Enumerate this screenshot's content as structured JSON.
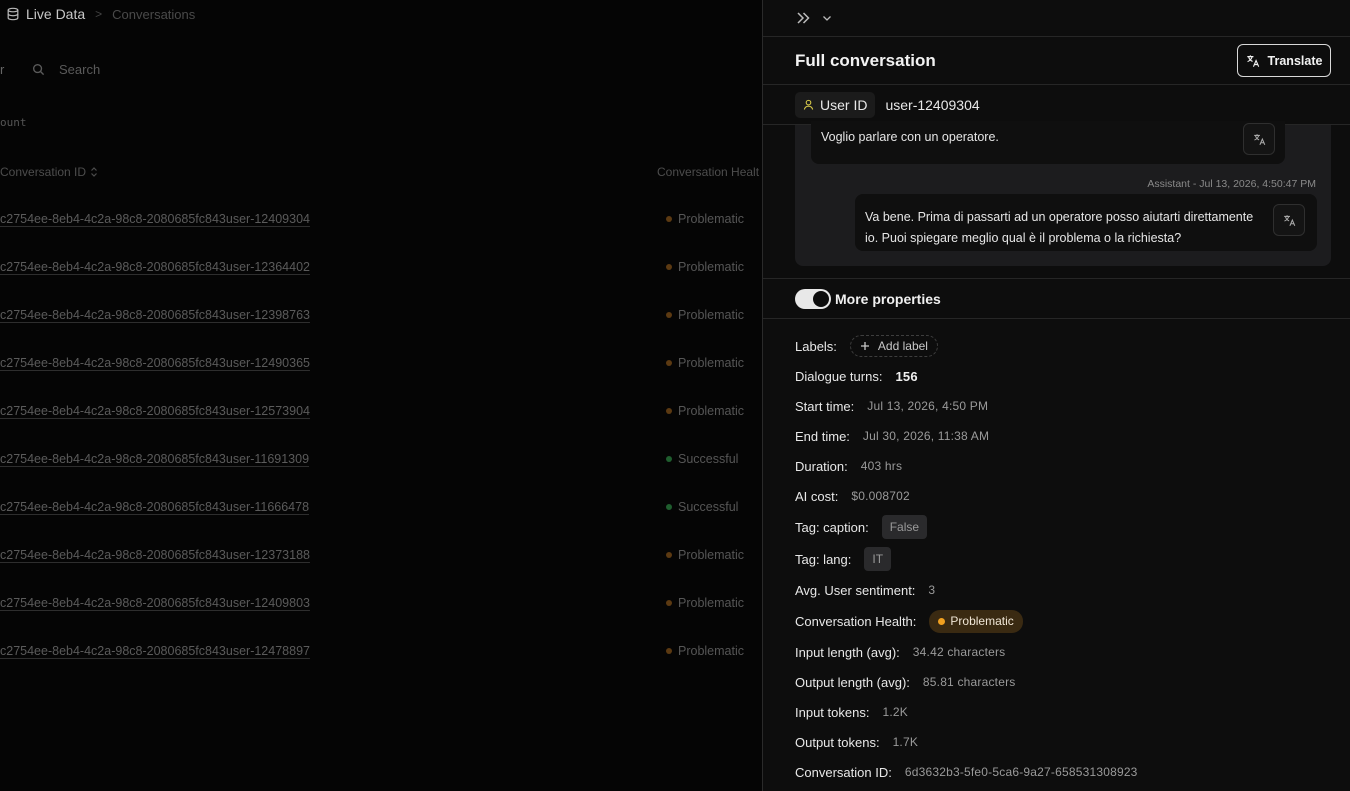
{
  "breadcrumb": {
    "root": "Live Data",
    "separator": ">",
    "current": "Conversations"
  },
  "list": {
    "filter_fragment": "r",
    "search_placeholder": "Search",
    "count_fragment": "ount",
    "columns": {
      "id": "Conversation ID",
      "health": "Conversation Healt"
    },
    "rows": [
      {
        "id": "c2754ee-8eb4-4c2a-98c8-2080685fc843user-12409304",
        "health": "Problematic"
      },
      {
        "id": "c2754ee-8eb4-4c2a-98c8-2080685fc843user-12364402",
        "health": "Problematic"
      },
      {
        "id": "c2754ee-8eb4-4c2a-98c8-2080685fc843user-12398763",
        "health": "Problematic"
      },
      {
        "id": "c2754ee-8eb4-4c2a-98c8-2080685fc843user-12490365",
        "health": "Problematic"
      },
      {
        "id": "c2754ee-8eb4-4c2a-98c8-2080685fc843user-12573904",
        "health": "Problematic"
      },
      {
        "id": "c2754ee-8eb4-4c2a-98c8-2080685fc843user-11691309",
        "health": "Successful"
      },
      {
        "id": "c2754ee-8eb4-4c2a-98c8-2080685fc843user-11666478",
        "health": "Successful"
      },
      {
        "id": "c2754ee-8eb4-4c2a-98c8-2080685fc843user-12373188",
        "health": "Problematic"
      },
      {
        "id": "c2754ee-8eb4-4c2a-98c8-2080685fc843user-12409803",
        "health": "Problematic"
      },
      {
        "id": "c2754ee-8eb4-4c2a-98c8-2080685fc843user-12478897",
        "health": "Problematic"
      }
    ]
  },
  "colors": {
    "problematic_dot": "#5c3a12",
    "successful_dot": "#1f5e2e",
    "problematic_badge_dot": "#f0a020"
  },
  "panel": {
    "title": "Full conversation",
    "translate_label": "Translate",
    "user_id_label": "User ID",
    "user_id_value": "user-12409304",
    "messages": {
      "user_text": "Voglio parlare con un operatore.",
      "assistant_meta": "Assistant - Jul 13, 2026, 4:50:47 PM",
      "assistant_text": "Va bene. Prima di passarti ad un operatore posso aiutarti direttamente io. Puoi spiegare meglio qual è il problema o la richiesta?"
    },
    "more_properties_label": "More properties",
    "more_properties_on": true,
    "props": {
      "labels_key": "Labels:",
      "add_label": "Add label",
      "turns_key": "Dialogue turns:",
      "turns_val": "156",
      "start_key": "Start time:",
      "start_val": "Jul 13, 2026, 4:50 PM",
      "end_key": "End time:",
      "end_val": "Jul 30, 2026, 11:38 AM",
      "duration_key": "Duration:",
      "duration_val": "403 hrs",
      "cost_key": "AI cost:",
      "cost_val": "$0.008702",
      "caption_key": "Tag: caption:",
      "caption_val": "False",
      "lang_key": "Tag: lang:",
      "lang_val": "IT",
      "sentiment_key": "Avg. User sentiment:",
      "sentiment_val": "3",
      "health_key": "Conversation Health:",
      "health_val": "Problematic",
      "input_len_key": "Input length (avg):",
      "input_len_val": "34.42 characters",
      "output_len_key": "Output length (avg):",
      "output_len_val": "85.81 characters",
      "input_tok_key": "Input tokens:",
      "input_tok_val": "1.2K",
      "output_tok_key": "Output tokens:",
      "output_tok_val": "1.7K",
      "conv_id_key": "Conversation ID:",
      "conv_id_val": "6d3632b3-5fe0-5ca6-9a27-658531308923"
    }
  }
}
